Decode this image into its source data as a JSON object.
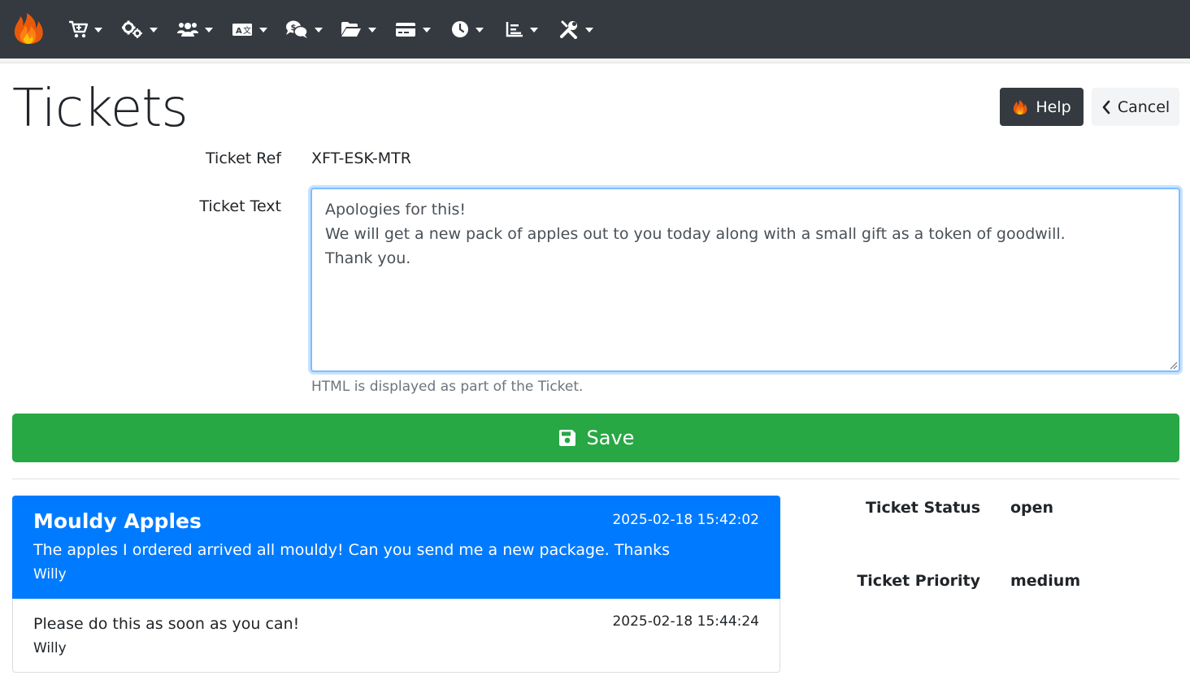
{
  "nav": {
    "menus": [
      {
        "name": "shop",
        "icon": "cart-icon"
      },
      {
        "name": "settings",
        "icon": "gears-icon"
      },
      {
        "name": "users",
        "icon": "users-icon"
      },
      {
        "name": "language",
        "icon": "language-icon"
      },
      {
        "name": "support",
        "icon": "comments-dollar-icon"
      },
      {
        "name": "files",
        "icon": "folder-open-icon"
      },
      {
        "name": "payments",
        "icon": "credit-card-icon"
      },
      {
        "name": "history",
        "icon": "clock-icon"
      },
      {
        "name": "reports",
        "icon": "chart-icon"
      },
      {
        "name": "tools",
        "icon": "tools-icon"
      }
    ]
  },
  "page": {
    "title": "Tickets",
    "help_label": "Help",
    "cancel_label": "Cancel"
  },
  "form": {
    "ref_label": "Ticket Ref",
    "ref_value": "XFT-ESK-MTR",
    "text_label": "Ticket Text",
    "text_value": "Apologies for this!\nWe will get a new pack of apples out to you today along with a small gift as a token of goodwill.\nThank you.",
    "help_text": "HTML is displayed as part of the Ticket.",
    "save_label": "Save"
  },
  "ticket": {
    "title": "Mouldy Apples",
    "date": "2025-02-18 15:42:02",
    "body": "The apples I ordered arrived all mouldy! Can you send me a new package. Thanks",
    "author": "Willy",
    "replies": [
      {
        "body": "Please do this as soon as you can!",
        "date": "2025-02-18 15:44:24",
        "author": "Willy"
      }
    ]
  },
  "side": {
    "status_label": "Ticket Status",
    "status_value": "open",
    "priority_label": "Ticket Priority",
    "priority_value": "medium"
  },
  "colors": {
    "navbar": "#343a40",
    "primary": "#007bff",
    "success": "#28a745"
  }
}
